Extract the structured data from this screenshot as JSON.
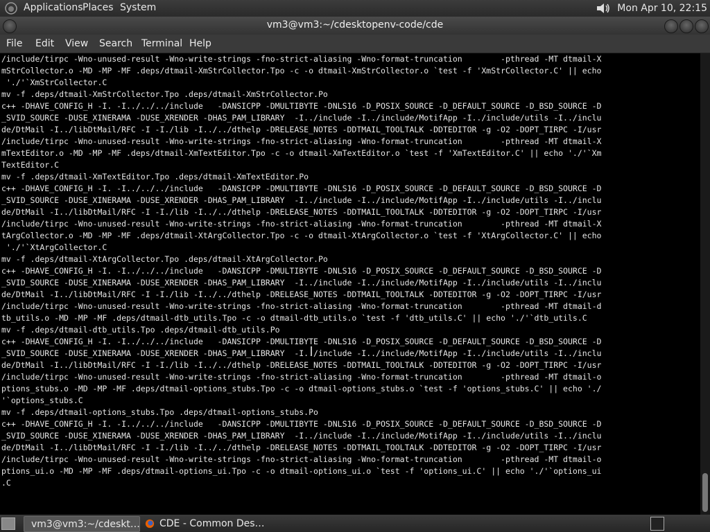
{
  "top_panel": {
    "menus": [
      "Applications",
      "Places",
      "System"
    ],
    "clock": "Mon Apr 10, 22:15"
  },
  "window": {
    "title": "vm3@vm3:~/cdesktopenv-code/cde"
  },
  "menubar": {
    "items": [
      "File",
      "Edit",
      "View",
      "Search",
      "Terminal",
      "Help"
    ]
  },
  "terminal": {
    "lines": [
      "/include/tirpc -Wno-unused-result -Wno-write-strings -fno-strict-aliasing -Wno-format-truncation        -pthread -MT dtmail-X",
      "mStrCollector.o -MD -MP -MF .deps/dtmail-XmStrCollector.Tpo -c -o dtmail-XmStrCollector.o `test -f 'XmStrCollector.C' || echo",
      " './'`XmStrCollector.C",
      "mv -f .deps/dtmail-XmStrCollector.Tpo .deps/dtmail-XmStrCollector.Po",
      "c++ -DHAVE_CONFIG_H -I. -I../../../include   -DANSICPP -DMULTIBYTE -DNLS16 -D_POSIX_SOURCE -D_DEFAULT_SOURCE -D_BSD_SOURCE -D",
      "_SVID_SOURCE -DUSE_XINERAMA -DUSE_XRENDER -DHAS_PAM_LIBRARY  -I../include -I../include/MotifApp -I../include/utils -I../inclu",
      "de/DtMail -I../libDtMail/RFC -I -I./lib -I../../dthelp -DRELEASE_NOTES -DDTMAIL_TOOLTALK -DDTEDITOR -g -O2 -DOPT_TIRPC -I/usr",
      "/include/tirpc -Wno-unused-result -Wno-write-strings -fno-strict-aliasing -Wno-format-truncation        -pthread -MT dtmail-X",
      "mTextEditor.o -MD -MP -MF .deps/dtmail-XmTextEditor.Tpo -c -o dtmail-XmTextEditor.o `test -f 'XmTextEditor.C' || echo './'`Xm",
      "TextEditor.C",
      "mv -f .deps/dtmail-XmTextEditor.Tpo .deps/dtmail-XmTextEditor.Po",
      "c++ -DHAVE_CONFIG_H -I. -I../../../include   -DANSICPP -DMULTIBYTE -DNLS16 -D_POSIX_SOURCE -D_DEFAULT_SOURCE -D_BSD_SOURCE -D",
      "_SVID_SOURCE -DUSE_XINERAMA -DUSE_XRENDER -DHAS_PAM_LIBRARY  -I../include -I../include/MotifApp -I../include/utils -I../inclu",
      "de/DtMail -I../libDtMail/RFC -I -I./lib -I../../dthelp -DRELEASE_NOTES -DDTMAIL_TOOLTALK -DDTEDITOR -g -O2 -DOPT_TIRPC -I/usr",
      "/include/tirpc -Wno-unused-result -Wno-write-strings -fno-strict-aliasing -Wno-format-truncation        -pthread -MT dtmail-X",
      "tArgCollector.o -MD -MP -MF .deps/dtmail-XtArgCollector.Tpo -c -o dtmail-XtArgCollector.o `test -f 'XtArgCollector.C' || echo",
      " './'`XtArgCollector.C",
      "mv -f .deps/dtmail-XtArgCollector.Tpo .deps/dtmail-XtArgCollector.Po",
      "c++ -DHAVE_CONFIG_H -I. -I../../../include   -DANSICPP -DMULTIBYTE -DNLS16 -D_POSIX_SOURCE -D_DEFAULT_SOURCE -D_BSD_SOURCE -D",
      "_SVID_SOURCE -DUSE_XINERAMA -DUSE_XRENDER -DHAS_PAM_LIBRARY  -I../include -I../include/MotifApp -I../include/utils -I../inclu",
      "de/DtMail -I../libDtMail/RFC -I -I./lib -I../../dthelp -DRELEASE_NOTES -DDTMAIL_TOOLTALK -DDTEDITOR -g -O2 -DOPT_TIRPC -I/usr",
      "/include/tirpc -Wno-unused-result -Wno-write-strings -fno-strict-aliasing -Wno-format-truncation        -pthread -MT dtmail-d",
      "tb_utils.o -MD -MP -MF .deps/dtmail-dtb_utils.Tpo -c -o dtmail-dtb_utils.o `test -f 'dtb_utils.C' || echo './'`dtb_utils.C",
      "mv -f .deps/dtmail-dtb_utils.Tpo .deps/dtmail-dtb_utils.Po",
      "c++ -DHAVE_CONFIG_H -I. -I../../../include   -DANSICPP -DMULTIBYTE -DNLS16 -D_POSIX_SOURCE -D_DEFAULT_SOURCE -D_BSD_SOURCE -D",
      "_SVID_SOURCE -DUSE_XINERAMA -DUSE_XRENDER -DHAS_PAM_LIBRARY  -I../include -I../include/MotifApp -I../include/utils -I../inclu",
      "de/DtMail -I../libDtMail/RFC -I -I./lib -I../../dthelp -DRELEASE_NOTES -DDTMAIL_TOOLTALK -DDTEDITOR -g -O2 -DOPT_TIRPC -I/usr",
      "/include/tirpc -Wno-unused-result -Wno-write-strings -fno-strict-aliasing -Wno-format-truncation        -pthread -MT dtmail-o",
      "ptions_stubs.o -MD -MP -MF .deps/dtmail-options_stubs.Tpo -c -o dtmail-options_stubs.o `test -f 'options_stubs.C' || echo './",
      "'`options_stubs.C",
      "mv -f .deps/dtmail-options_stubs.Tpo .deps/dtmail-options_stubs.Po",
      "c++ -DHAVE_CONFIG_H -I. -I../../../include   -DANSICPP -DMULTIBYTE -DNLS16 -D_POSIX_SOURCE -D_DEFAULT_SOURCE -D_BSD_SOURCE -D",
      "_SVID_SOURCE -DUSE_XINERAMA -DUSE_XRENDER -DHAS_PAM_LIBRARY  -I../include -I../include/MotifApp -I../include/utils -I../inclu",
      "de/DtMail -I../libDtMail/RFC -I -I./lib -I../../dthelp -DRELEASE_NOTES -DDTMAIL_TOOLTALK -DDTEDITOR -g -O2 -DOPT_TIRPC -I/usr",
      "/include/tirpc -Wno-unused-result -Wno-write-strings -fno-strict-aliasing -Wno-format-truncation        -pthread -MT dtmail-o",
      "ptions_ui.o -MD -MP -MF .deps/dtmail-options_ui.Tpo -c -o dtmail-options_ui.o `test -f 'options_ui.C' || echo './'`options_ui",
      ".C"
    ]
  },
  "taskbar": {
    "tasks": [
      "vm3@vm3:~/cdeskt…",
      "CDE - Common Des…"
    ]
  }
}
